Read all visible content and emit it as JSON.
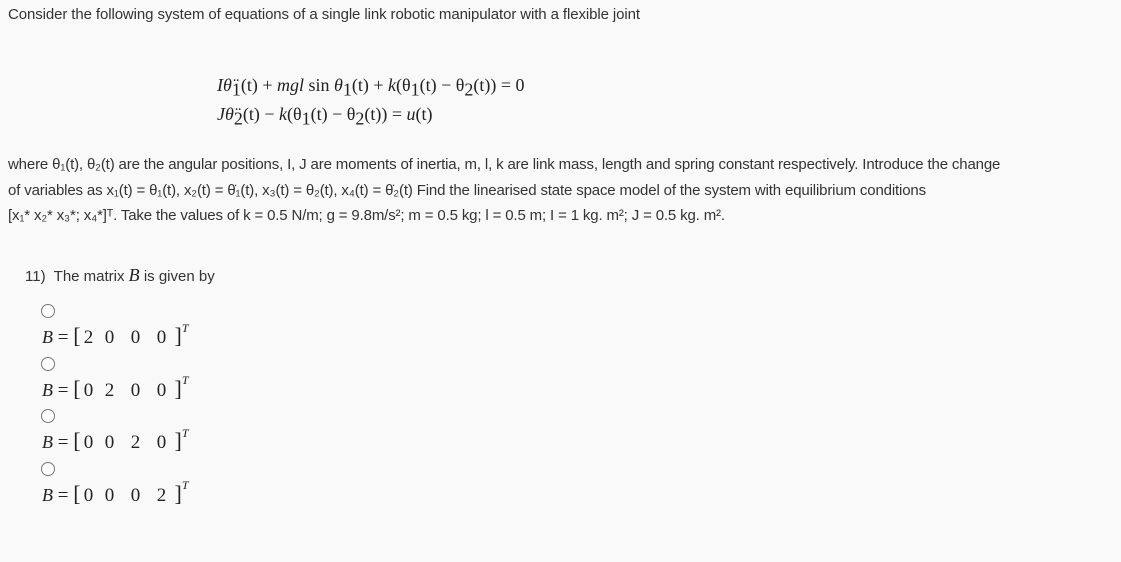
{
  "intro": "Consider the following system of equations of a single link robotic manipulator with a flexible joint",
  "equations": {
    "eq1": {
      "lhs_I": "I",
      "theta": "θ̈",
      "sub1": "1",
      "t1": "(t) + ",
      "mgl": "mgl",
      "sin": " sin ",
      "theta2": "θ",
      "sub2": "1",
      "t2": "(t) + ",
      "k": "k",
      "rest": "(θ",
      "sub3": "1",
      "rest2": "(t) − θ",
      "sub4": "2",
      "rest3": "(t)) = 0"
    },
    "eq2": {
      "lhs_J": "J",
      "theta": "θ̈",
      "sub1": "2",
      "t1": "(t) − ",
      "k": "k",
      "rest": "(θ",
      "sub2": "1",
      "rest2": "(t) − θ",
      "sub3": "2",
      "rest3": "(t)) = ",
      "u": "u",
      "rest4": "(t)"
    }
  },
  "description": {
    "line1_text": "where θ₁(t), θ₂(t) are the angular positions, I, J are moments of inertia, m, l, k are link mass, length and spring constant respectively. Introduce the change",
    "line2_text": "of variables as x₁(t) = θ₁(t), x₂(t) = θ̇₁(t), x₃(t) = θ₂(t), x₄(t) = θ̇₂(t) Find the linearised state space model of the system with equilibrium conditions",
    "line3_text": "[x₁* x₂* x₃*; x₄*]ᵀ. Take the values of k = 0.5 N/m; g = 9.8m/s²; m = 0.5 kg; l = 0.5 m; I = 1 kg. m²; J = 0.5 kg. m².",
    "where": "where ",
    "angular_positions": " are the angular positions, ",
    "moments": " are moments of inertia, ",
    "link_mass": " are link mass, length and spring constant respectively. Introduce the change",
    "of_variables": "of variables as ",
    "find": " Find the linearised state space model of the system with equilibrium conditions",
    "take_values": ". Take the values of ",
    "values": "k = 0.5 N/m; g = 9.8m/s²; m = 0.5 kg; l = 0.5 m; I = 1 kg. m²; J = 0.5 kg. m²"
  },
  "question": {
    "number": "11)",
    "text_before": "The matrix ",
    "symbol": "B",
    "text_after": " is given by",
    "options": [
      {
        "label": "B",
        "entries": [
          "2",
          "0",
          "0",
          "0"
        ],
        "sup": "T",
        "selected": false
      },
      {
        "label": "B",
        "entries": [
          "0",
          "2",
          "0",
          "0"
        ],
        "sup": "T",
        "selected": false
      },
      {
        "label": "B",
        "entries": [
          "0",
          "0",
          "2",
          "0"
        ],
        "sup": "T",
        "selected": false
      },
      {
        "label": "B",
        "entries": [
          "0",
          "0",
          "0",
          "2"
        ],
        "sup": "T",
        "selected": false
      }
    ]
  }
}
